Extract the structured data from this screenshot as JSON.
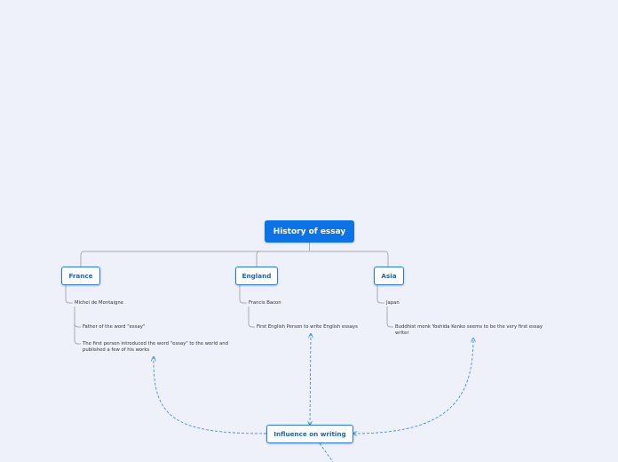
{
  "colors": {
    "background": "#eef0fa",
    "root_fill": "#0d72e6",
    "topic_border": "#2a7be0",
    "topic_text": "#1a62c8",
    "connector": "#a9aab5",
    "relation": "#3f8ee0"
  },
  "root": {
    "label": "History of essay"
  },
  "topics": {
    "france": {
      "label": "France",
      "items": [
        "Michel de Montaigne",
        "Father of the word \"essay\"",
        "The first person introduced the word \"essay\" to the world and published a few of his works"
      ]
    },
    "england": {
      "label": "England",
      "items": [
        "Francis Bacon",
        "First English Person to write English essays"
      ]
    },
    "asia": {
      "label": "Asia",
      "items": [
        "Japan",
        "Buddhist monk Yoshida Kenko seems to be the very first essay writer"
      ]
    }
  },
  "floating": {
    "label": "Influence on writing"
  }
}
